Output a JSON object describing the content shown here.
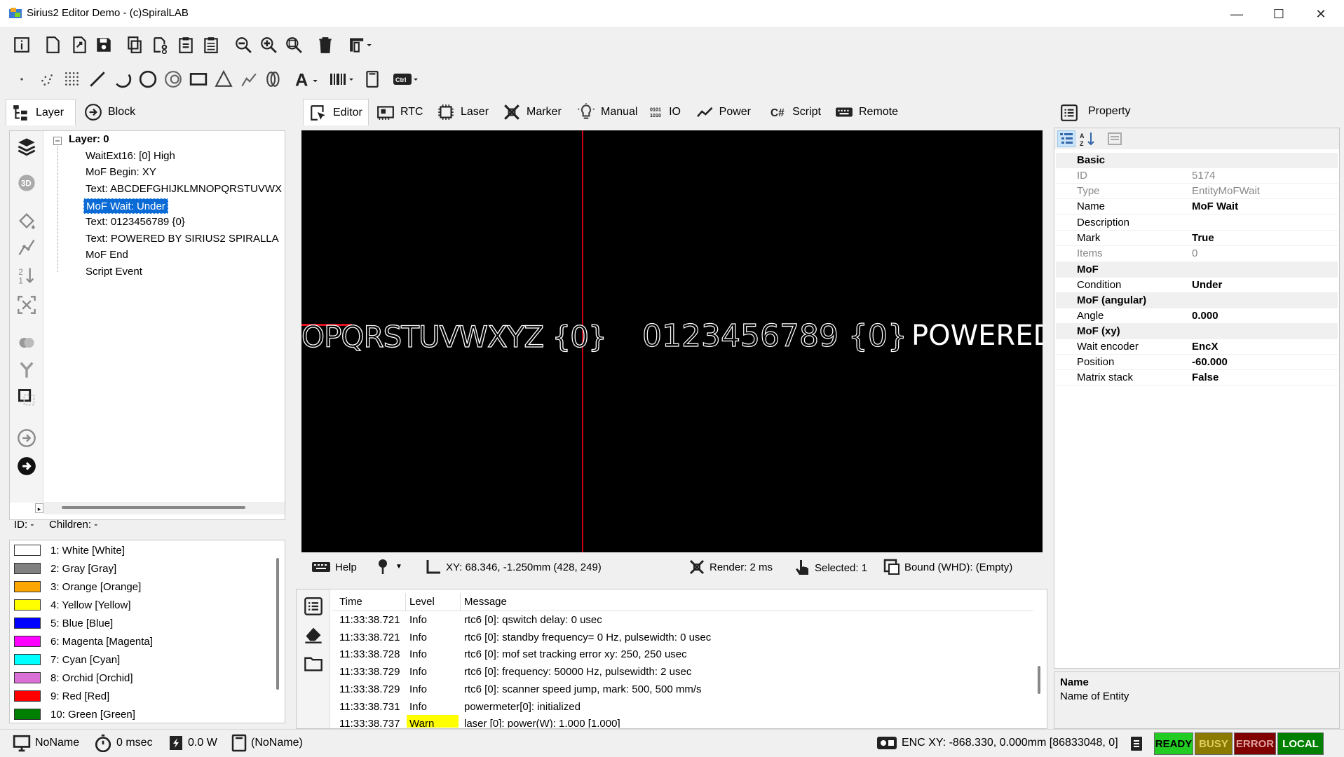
{
  "window": {
    "title": "Sirius2 Editor Demo - (c)SpiralLAB"
  },
  "left_tabs": [
    {
      "label": "Layer"
    },
    {
      "label": "Block"
    }
  ],
  "tree": {
    "root": "Layer: 0",
    "items": [
      {
        "label": "WaitExt16: [0] High"
      },
      {
        "label": "MoF Begin: XY"
      },
      {
        "label": "Text: ABCDEFGHIJKLMNOPQRSTUVWX"
      },
      {
        "label": "MoF Wait: Under"
      },
      {
        "label": "Text: 0123456789 {0}"
      },
      {
        "label": "Text: POWERED BY SIRIUS2 SPIRALLA"
      },
      {
        "label": "MoF End"
      },
      {
        "label": "Script Event"
      }
    ],
    "footer": {
      "id": "ID: -",
      "children": "Children: -"
    }
  },
  "colors": [
    {
      "label": "1: White [White]",
      "hex": "#ffffff"
    },
    {
      "label": "2: Gray [Gray]",
      "hex": "#808080"
    },
    {
      "label": "3: Orange [Orange]",
      "hex": "#ffa500"
    },
    {
      "label": "4: Yellow [Yellow]",
      "hex": "#ffff00"
    },
    {
      "label": "5: Blue [Blue]",
      "hex": "#0000ff"
    },
    {
      "label": "6: Magenta [Magenta]",
      "hex": "#ff00ff"
    },
    {
      "label": "7: Cyan [Cyan]",
      "hex": "#00ffff"
    },
    {
      "label": "8: Orchid [Orchid]",
      "hex": "#da70d6"
    },
    {
      "label": "9: Red [Red]",
      "hex": "#ff0000"
    },
    {
      "label": "10: Green [Green]",
      "hex": "#008000"
    }
  ],
  "center_tabs": [
    {
      "label": "Editor"
    },
    {
      "label": "RTC"
    },
    {
      "label": "Laser"
    },
    {
      "label": "Marker"
    },
    {
      "label": "Manual"
    },
    {
      "label": "IO"
    },
    {
      "label": "Power"
    },
    {
      "label": "Script"
    },
    {
      "label": "Remote"
    }
  ],
  "canvas": {
    "text1": "OPQRSTUVWXYZ {0}",
    "text2": "0123456789 {0}",
    "text3": "POWERED"
  },
  "canvas_status": {
    "help": "Help",
    "xy": "XY: 68.346, -1.250mm (428, 249)",
    "render": "Render: 2 ms",
    "selected": "Selected: 1",
    "bound": "Bound (WHD): (Empty)"
  },
  "log": {
    "headers": {
      "time": "Time",
      "level": "Level",
      "message": "Message"
    },
    "rows": [
      {
        "time": "11:33:38.721",
        "level": "Info",
        "message": "rtc6 [0]: qswitch delay: 0 usec"
      },
      {
        "time": "11:33:38.721",
        "level": "Info",
        "message": "rtc6 [0]: standby frequency= 0 Hz, pulsewidth: 0 usec"
      },
      {
        "time": "11:33:38.728",
        "level": "Info",
        "message": "rtc6 [0]: mof set tracking error xy: 250, 250 usec"
      },
      {
        "time": "11:33:38.729",
        "level": "Info",
        "message": "rtc6 [0]: frequency: 50000 Hz, pulsewidth: 2 usec"
      },
      {
        "time": "11:33:38.729",
        "level": "Info",
        "message": "rtc6 [0]: scanner speed jump, mark: 500, 500 mm/s"
      },
      {
        "time": "11:33:38.731",
        "level": "Info",
        "message": "powermeter[0]: initialized"
      },
      {
        "time": "11:33:38.737",
        "level": "Warn",
        "message": "laser [0]: power(W): 1.000 [1.000]"
      }
    ]
  },
  "property": {
    "title": "Property",
    "categories": {
      "basic": "Basic",
      "mof": "MoF",
      "mof_angular": "MoF (angular)",
      "mof_xy": "MoF (xy)"
    },
    "basic": [
      {
        "name": "ID",
        "value": "5174"
      },
      {
        "name": "Type",
        "value": "EntityMoFWait"
      },
      {
        "name": "Name",
        "value": "MoF Wait"
      },
      {
        "name": "Description",
        "value": ""
      },
      {
        "name": "Mark",
        "value": "True"
      },
      {
        "name": "Items",
        "value": "0"
      }
    ],
    "mof": [
      {
        "name": "Condition",
        "value": "Under"
      }
    ],
    "mof_angular": [
      {
        "name": "Angle",
        "value": "0.000"
      }
    ],
    "mof_xy": [
      {
        "name": "Wait encoder",
        "value": "EncX"
      },
      {
        "name": "Position",
        "value": "-60.000"
      },
      {
        "name": "Matrix stack",
        "value": "False"
      }
    ],
    "help_title": "Name",
    "help_text": "Name of Entity"
  },
  "statusbar": {
    "name": "NoName",
    "time": "0 msec",
    "power": "0.0 W",
    "file": "(NoName)",
    "enc": "ENC XY: -868.330, 0.000mm [86833048, 0]",
    "ready": "READY",
    "busy": "BUSY",
    "error": "ERROR",
    "local": "LOCAL"
  }
}
